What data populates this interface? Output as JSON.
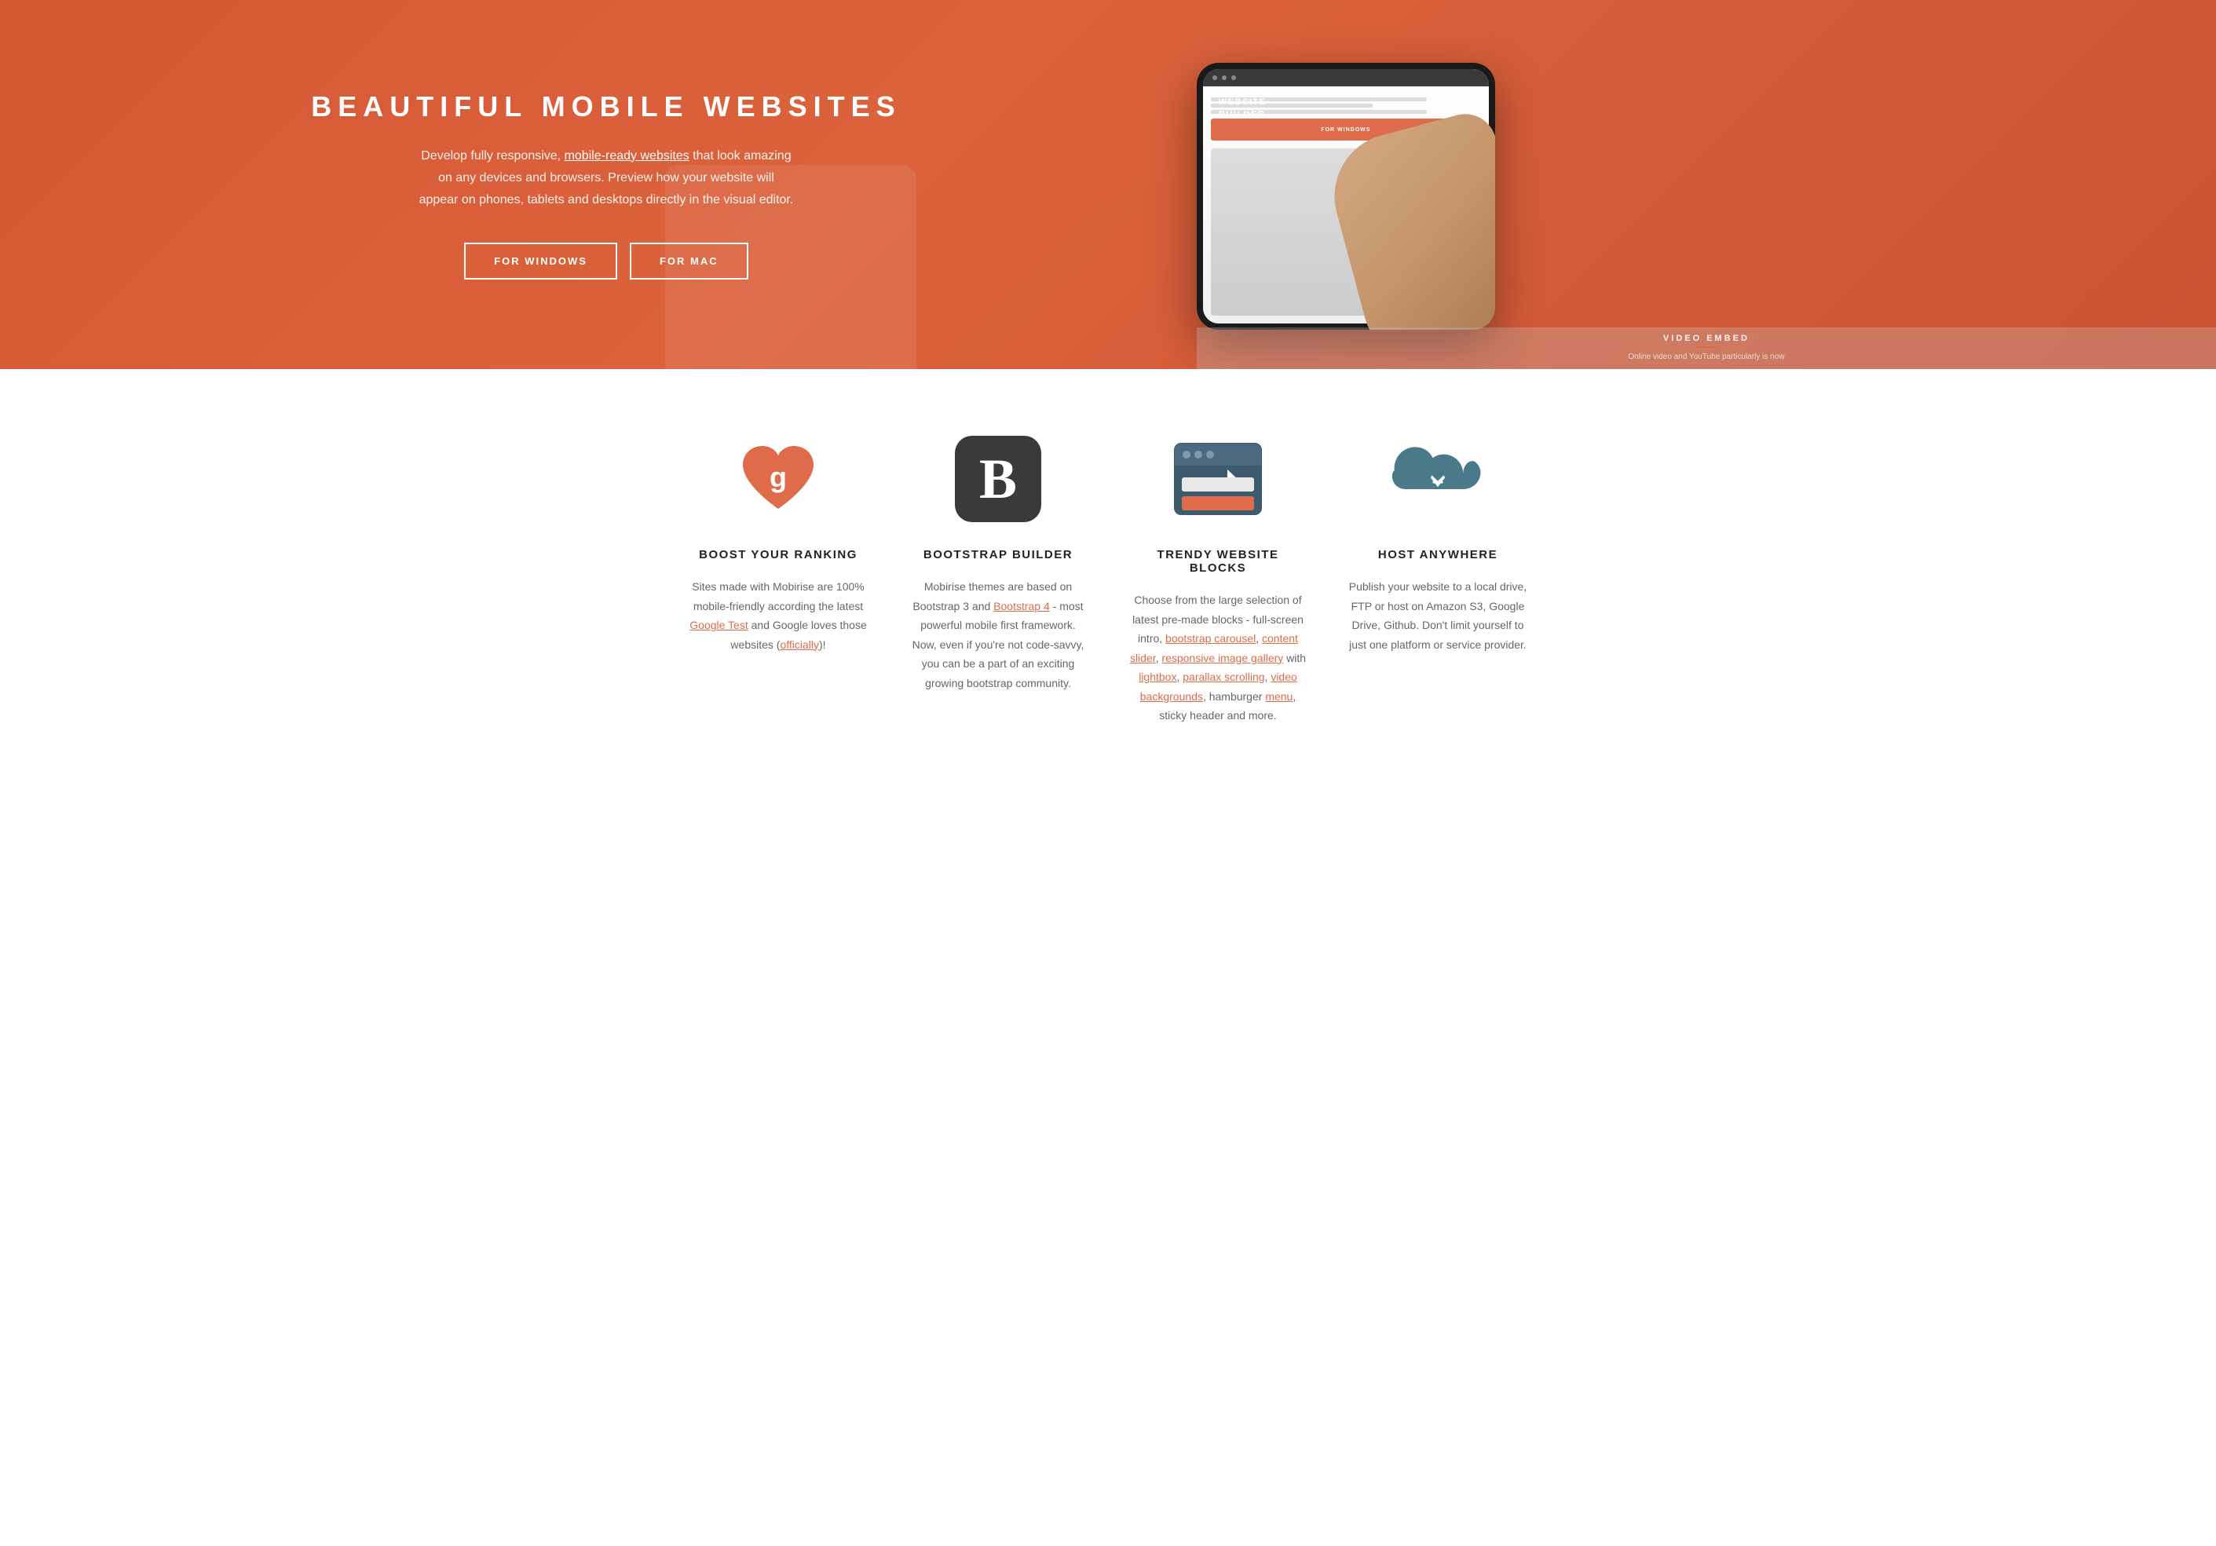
{
  "hero": {
    "title": "BEAUTIFUL MOBILE WEBSITES",
    "description_plain": "Develop fully responsive, ",
    "description_link": "mobile-ready websites",
    "description_cont": " that look amazing on any devices and browsers. Preview how your website will appear on phones, tablets and desktops directly in the visual editor.",
    "btn_windows": "FOR WINDOWS",
    "btn_mac": "FOR MAC",
    "phone_brand_line1": "MOBIRISE",
    "phone_brand_line2": "WEBSITE",
    "phone_brand_line3": "BUILDER",
    "phone_btn": "FOR WINDOWS",
    "video_label": "VIDEO EMBED",
    "video_text": "Online video and YouTube particularly is now"
  },
  "features": [
    {
      "id": "boost",
      "title": "BOOST YOUR RANKING",
      "description_parts": [
        {
          "type": "text",
          "value": "Sites made with Mobirise are 100% mobile-friendly according the latest "
        },
        {
          "type": "link",
          "value": "Google Test"
        },
        {
          "type": "text",
          "value": " and Google loves those websites ("
        },
        {
          "type": "link",
          "value": "officially"
        },
        {
          "type": "text",
          "value": ")!"
        }
      ]
    },
    {
      "id": "bootstrap",
      "title": "BOOTSTRAP BUILDER",
      "description_parts": [
        {
          "type": "text",
          "value": "Mobirise themes are based on Bootstrap 3 and "
        },
        {
          "type": "link",
          "value": "Bootstrap 4"
        },
        {
          "type": "text",
          "value": " - most powerful mobile first framework. Now, even if you're not code-savvy, you can be a part of an exciting growing bootstrap community."
        }
      ]
    },
    {
      "id": "blocks",
      "title": "TRENDY WEBSITE BLOCKS",
      "description_parts": [
        {
          "type": "text",
          "value": "Choose from the large selection of latest pre-made blocks - full-screen intro, "
        },
        {
          "type": "link",
          "value": "bootstrap carousel"
        },
        {
          "type": "text",
          "value": ", "
        },
        {
          "type": "link",
          "value": "content slider"
        },
        {
          "type": "text",
          "value": ", "
        },
        {
          "type": "link",
          "value": "responsive image gallery"
        },
        {
          "type": "text",
          "value": " with "
        },
        {
          "type": "link",
          "value": "lightbox"
        },
        {
          "type": "text",
          "value": ", "
        },
        {
          "type": "link",
          "value": "parallax scrolling"
        },
        {
          "type": "text",
          "value": ", "
        },
        {
          "type": "link",
          "value": "video backgrounds"
        },
        {
          "type": "text",
          "value": ", hamburger "
        },
        {
          "type": "link",
          "value": "menu"
        },
        {
          "type": "text",
          "value": ", sticky header and more."
        }
      ]
    },
    {
      "id": "host",
      "title": "HOST ANYWHERE",
      "description_parts": [
        {
          "type": "text",
          "value": "Publish your website to a local drive, FTP or host on Amazon S3, Google Drive, Github. Don't limit yourself to just one platform or service provider."
        }
      ]
    }
  ]
}
